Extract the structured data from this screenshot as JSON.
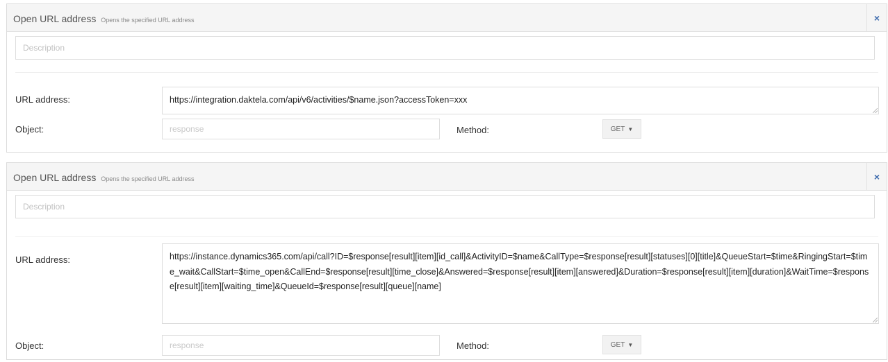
{
  "panels": [
    {
      "title": "Open URL address",
      "subtitle": "Opens the specified URL address",
      "close_icon": "×",
      "description_placeholder": "Description",
      "url_label": "URL address:",
      "url_value": "https://integration.daktela.com/api/v6/activities/$name.json?accessToken=xxx",
      "object_label": "Object:",
      "object_placeholder": "response",
      "method_label": "Method:",
      "method_value": "GET"
    },
    {
      "title": "Open URL address",
      "subtitle": "Opens the specified URL address",
      "close_icon": "×",
      "description_placeholder": "Description",
      "url_label": "URL address:",
      "url_value": "https://instance.dynamics365.com/api/call?ID=$response[result][item][id_call]&ActivityID=$name&CallType=$response[result][statuses][0][title]&QueueStart=$time&RingingStart=$time_wait&CallStart=$time_open&CallEnd=$response[result][time_close]&Answered=$response[result][item][answered]&Duration=$response[result][item][duration]&WaitTime=$response[result][item][waiting_time]&QueueId=$response[result][queue][name]",
      "object_label": "Object:",
      "object_placeholder": "response",
      "method_label": "Method:",
      "method_value": "GET"
    }
  ],
  "icons": {
    "close": "close-icon",
    "caret": "caret-down-icon"
  },
  "colors": {
    "accent": "#3f6cae",
    "header_bg": "#f5f5f5",
    "border": "#dcdcdc"
  }
}
